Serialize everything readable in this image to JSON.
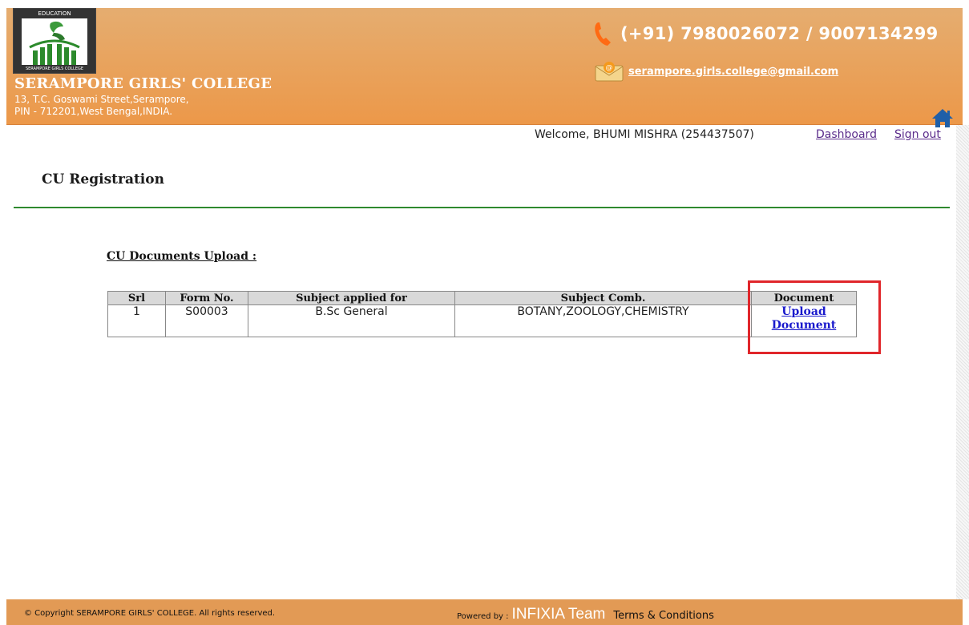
{
  "header": {
    "logo_top_text": "EDUCATION",
    "logo_bottom_text": "SERAMPORE GIRLS COLLEGE",
    "college_name": "SERAMPORE GIRLS' COLLEGE",
    "address_line1": "13, T.C. Goswami Street,Serampore,",
    "address_line2": "PIN - 712201,West Bengal,INDIA.",
    "phone": "(+91) 7980026072 / 9007134299",
    "email": "serampore.girls.college@gmail.com",
    "icons": {
      "phone": "phone-icon",
      "email": "email-envelope-icon",
      "home": "home-icon"
    }
  },
  "user_bar": {
    "welcome_text": "Welcome, BHUMI MISHRA (254437507)",
    "dashboard_label": "Dashboard",
    "signout_label": "Sign out"
  },
  "page": {
    "title": "CU Registration",
    "section_heading": "CU Documents Upload :"
  },
  "table": {
    "headers": [
      "Srl",
      "Form No.",
      "Subject applied for",
      "Subject Comb.",
      "Document"
    ],
    "rows": [
      {
        "srl": "1",
        "form_no": "S00003",
        "subject": "B.Sc General",
        "combination": "BOTANY,ZOOLOGY,CHEMISTRY",
        "document_link_line1": "Upload",
        "document_link_line2": "Document"
      }
    ]
  },
  "footer": {
    "copyright": "© Copyright SERAMPORE GIRLS' COLLEGE. All rights reserved.",
    "powered_label": "Powered by :",
    "powered_team": "INFIXIA Team",
    "terms": "Terms & Conditions"
  },
  "colors": {
    "header_top": "#e5ad70",
    "header_bottom": "#ec9849",
    "green_rule": "#2f8a2f",
    "highlight": "#e0262b",
    "link_blue": "#1a1acc",
    "link_purple": "#5b2c8b"
  }
}
